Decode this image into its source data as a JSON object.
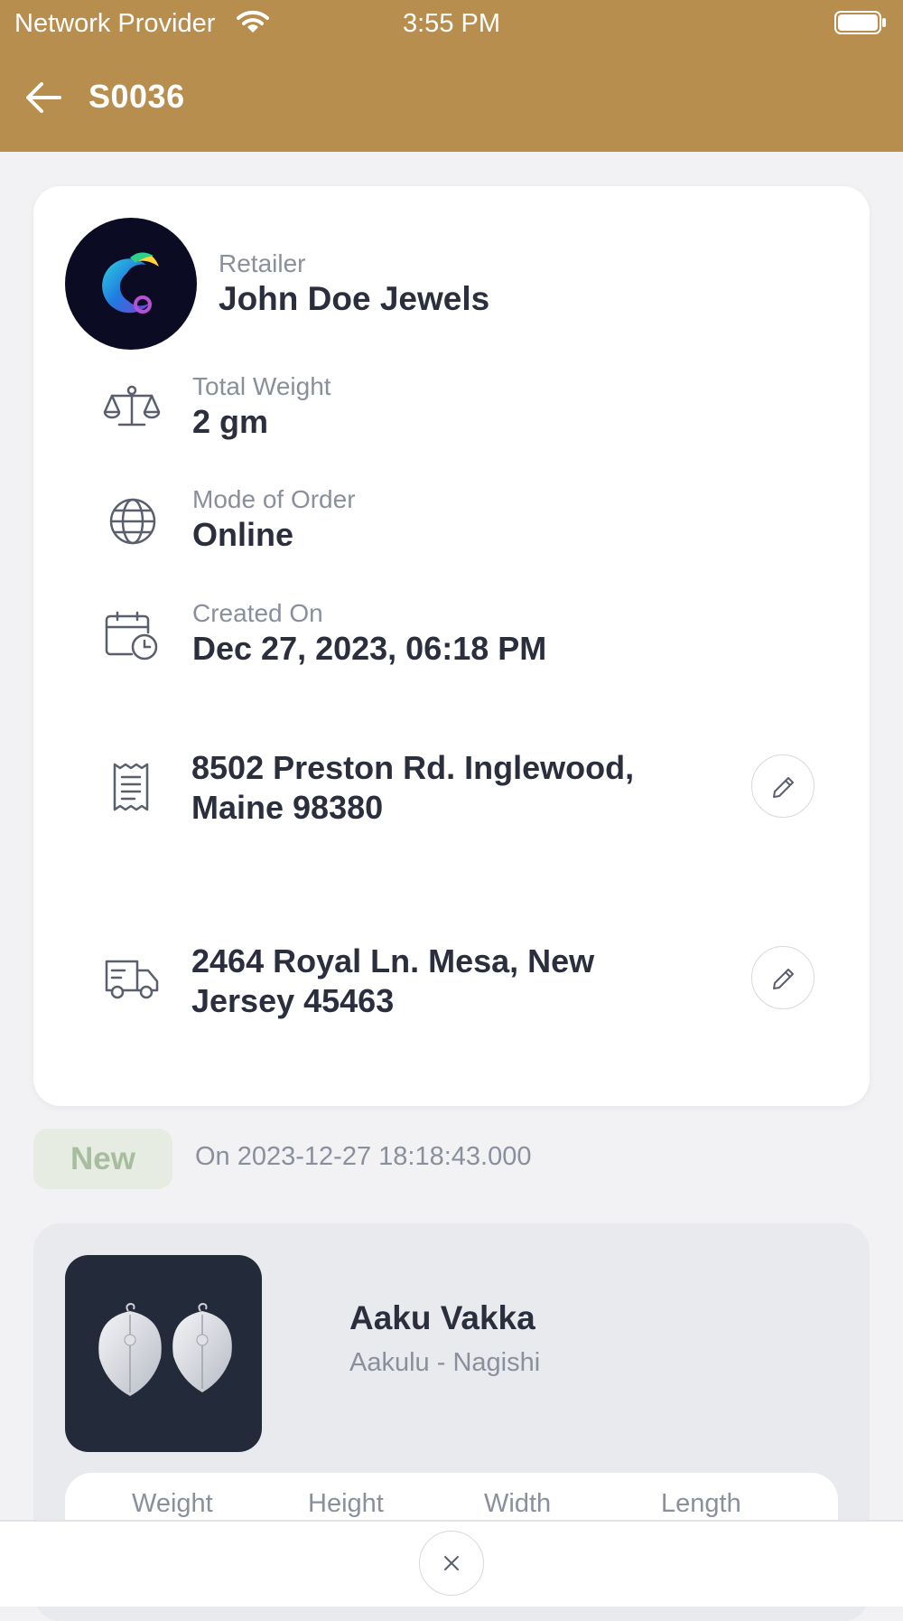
{
  "status_bar": {
    "carrier": "Network Provider",
    "time": "3:55 PM"
  },
  "header": {
    "title": "S0036"
  },
  "retailer": {
    "caption": "Retailer",
    "name": "John Doe Jewels"
  },
  "details": {
    "total_weight": {
      "caption": "Total Weight",
      "value": "2 gm"
    },
    "mode_of_order": {
      "caption": "Mode of Order",
      "value": "Online"
    },
    "created_on": {
      "caption": "Created On",
      "value": "Dec 27, 2023, 06:18 PM"
    }
  },
  "addresses": {
    "billing": {
      "line1": "8502 Preston Rd. Inglewood,",
      "line2": "Maine 98380"
    },
    "shipping": {
      "line1": "2464 Royal Ln. Mesa, New",
      "line2": "Jersey 45463"
    }
  },
  "order_status": {
    "badge": "New",
    "date": "On 2023-12-27 18:18:43.000"
  },
  "product": {
    "name": "Aaku Vakka",
    "subtitle": "Aakulu - Nagishi",
    "specs": [
      "Weight",
      "Height",
      "Width",
      "Length"
    ]
  },
  "icons": {
    "back": "arrow-left-icon",
    "weight": "scale-icon",
    "mode": "globe-icon",
    "created": "calendar-clock-icon",
    "billing": "receipt-icon",
    "shipping": "truck-icon",
    "edit": "pencil-icon",
    "close": "close-icon"
  },
  "colors": {
    "header": "#b88e4e",
    "badge_bg": "#e6ece1",
    "badge_text": "#a8bda0"
  }
}
